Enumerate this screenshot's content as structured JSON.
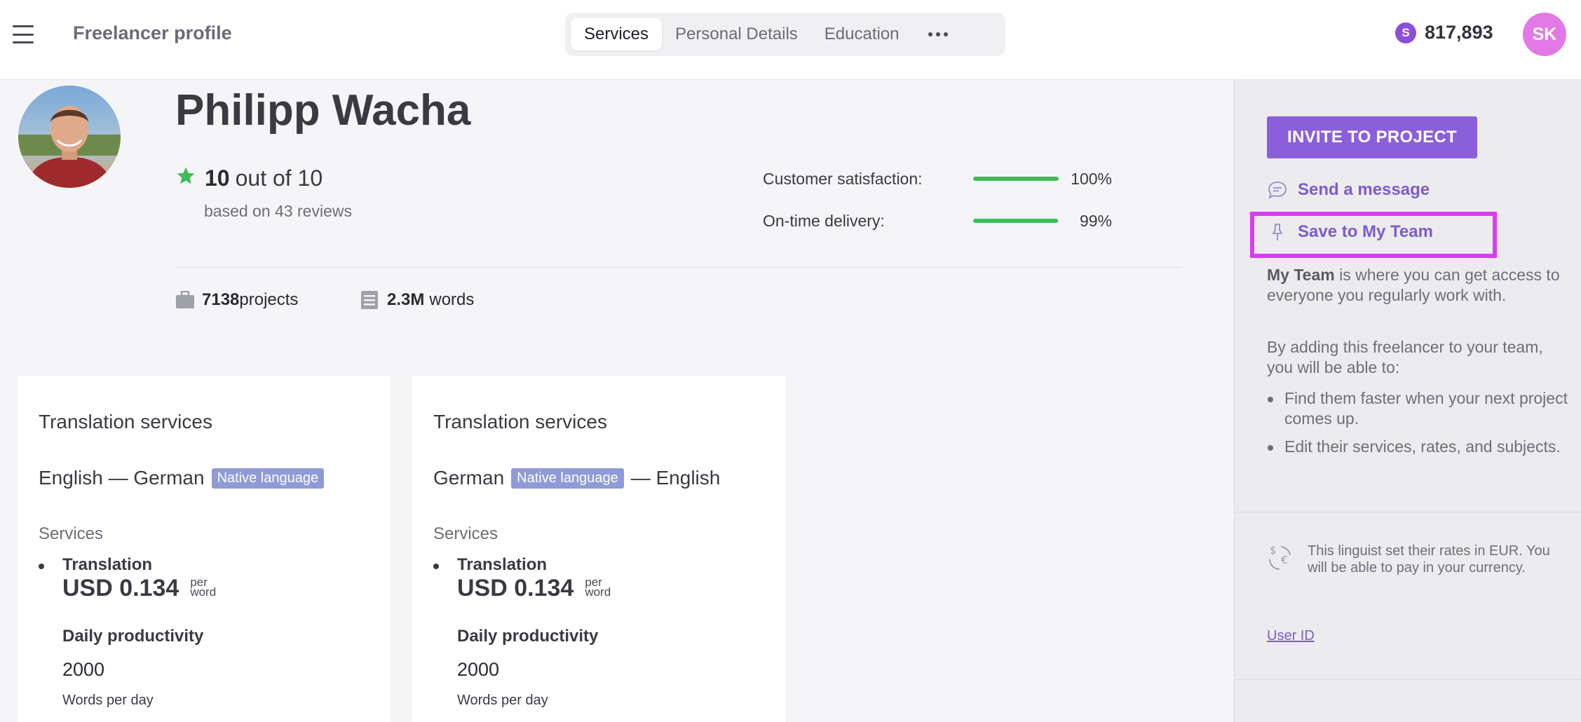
{
  "header": {
    "brand": "Freelancer profile",
    "tabs": [
      {
        "label": "Services",
        "active": true
      },
      {
        "label": "Personal Details",
        "active": false
      },
      {
        "label": "Education",
        "active": false
      }
    ],
    "more_icon": "more-horizontal-icon",
    "balance": {
      "icon": "coin-icon",
      "icon_letter": "S",
      "value": "817,893"
    },
    "avatar_initials": "SK"
  },
  "profile": {
    "name": "Philipp Wacha",
    "rating": {
      "score": "10",
      "suffix": "out of 10",
      "reviews": "based on 43 reviews"
    },
    "metrics": [
      {
        "label": "Customer satisfaction:",
        "value": "100%",
        "level": 1.0
      },
      {
        "label": "On-time delivery:",
        "value": "99%",
        "level": 0.99
      }
    ],
    "stats": {
      "projects_count": "7138",
      "projects_label": "projects",
      "words_count": "2.3M",
      "words_label": "words"
    }
  },
  "cards": [
    {
      "title": "Translation services",
      "source_lang": "English",
      "target_lang": "German",
      "native_badge": "Native language",
      "native_side": "target",
      "services_heading": "Services",
      "service_name": "Translation",
      "price": "USD 0.134",
      "per_1": "per",
      "per_2": "word",
      "productivity_label": "Daily productivity",
      "productivity_value": "2000",
      "productivity_unit": "Words per day"
    },
    {
      "title": "Translation services",
      "source_lang": "German",
      "target_lang": "English",
      "native_badge": "Native language",
      "native_side": "source",
      "services_heading": "Services",
      "service_name": "Translation",
      "price": "USD 0.134",
      "per_1": "per",
      "per_2": "word",
      "productivity_label": "Daily productivity",
      "productivity_value": "2000",
      "productivity_unit": "Words per day"
    }
  ],
  "sidebar": {
    "invite_label": "INVITE TO PROJECT",
    "message_label": "Send a message",
    "save_label": "Save to My Team",
    "team_bold": "My Team",
    "team_text": " is where you can get access to everyone you regularly work with.",
    "adding_text": "By adding this freelancer to your team, you will be able to:",
    "benefits": [
      "Find them faster when your next project comes up.",
      "Edit their services, rates, and subjects."
    ],
    "currency_note": "This linguist set their rates in EUR. You will be able to pay in your currency.",
    "user_id_label": "User ID"
  },
  "colors": {
    "accent": "#8b5fd9",
    "highlight": "#d93cf2",
    "success": "#3dbc5a",
    "badge": "#8f9bd6",
    "avatar": "#e279e6"
  }
}
